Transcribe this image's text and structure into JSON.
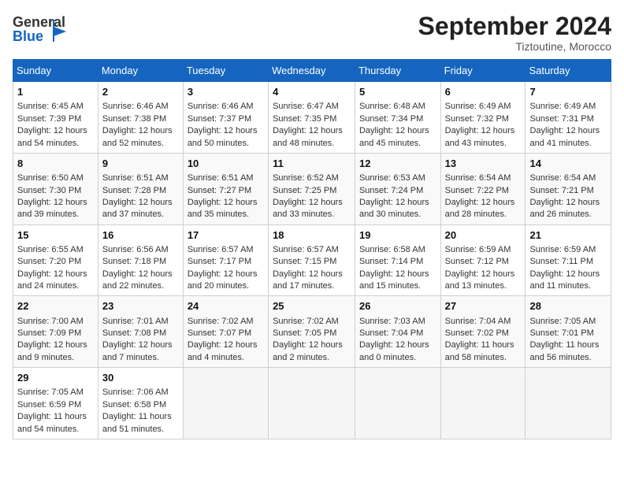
{
  "header": {
    "logo_general": "General",
    "logo_blue": "Blue",
    "month_title": "September 2024",
    "location": "Tiztoutine, Morocco"
  },
  "columns": [
    "Sunday",
    "Monday",
    "Tuesday",
    "Wednesday",
    "Thursday",
    "Friday",
    "Saturday"
  ],
  "weeks": [
    [
      {
        "day": "1",
        "sunrise": "Sunrise: 6:45 AM",
        "sunset": "Sunset: 7:39 PM",
        "daylight": "Daylight: 12 hours and 54 minutes."
      },
      {
        "day": "2",
        "sunrise": "Sunrise: 6:46 AM",
        "sunset": "Sunset: 7:38 PM",
        "daylight": "Daylight: 12 hours and 52 minutes."
      },
      {
        "day": "3",
        "sunrise": "Sunrise: 6:46 AM",
        "sunset": "Sunset: 7:37 PM",
        "daylight": "Daylight: 12 hours and 50 minutes."
      },
      {
        "day": "4",
        "sunrise": "Sunrise: 6:47 AM",
        "sunset": "Sunset: 7:35 PM",
        "daylight": "Daylight: 12 hours and 48 minutes."
      },
      {
        "day": "5",
        "sunrise": "Sunrise: 6:48 AM",
        "sunset": "Sunset: 7:34 PM",
        "daylight": "Daylight: 12 hours and 45 minutes."
      },
      {
        "day": "6",
        "sunrise": "Sunrise: 6:49 AM",
        "sunset": "Sunset: 7:32 PM",
        "daylight": "Daylight: 12 hours and 43 minutes."
      },
      {
        "day": "7",
        "sunrise": "Sunrise: 6:49 AM",
        "sunset": "Sunset: 7:31 PM",
        "daylight": "Daylight: 12 hours and 41 minutes."
      }
    ],
    [
      {
        "day": "8",
        "sunrise": "Sunrise: 6:50 AM",
        "sunset": "Sunset: 7:30 PM",
        "daylight": "Daylight: 12 hours and 39 minutes."
      },
      {
        "day": "9",
        "sunrise": "Sunrise: 6:51 AM",
        "sunset": "Sunset: 7:28 PM",
        "daylight": "Daylight: 12 hours and 37 minutes."
      },
      {
        "day": "10",
        "sunrise": "Sunrise: 6:51 AM",
        "sunset": "Sunset: 7:27 PM",
        "daylight": "Daylight: 12 hours and 35 minutes."
      },
      {
        "day": "11",
        "sunrise": "Sunrise: 6:52 AM",
        "sunset": "Sunset: 7:25 PM",
        "daylight": "Daylight: 12 hours and 33 minutes."
      },
      {
        "day": "12",
        "sunrise": "Sunrise: 6:53 AM",
        "sunset": "Sunset: 7:24 PM",
        "daylight": "Daylight: 12 hours and 30 minutes."
      },
      {
        "day": "13",
        "sunrise": "Sunrise: 6:54 AM",
        "sunset": "Sunset: 7:22 PM",
        "daylight": "Daylight: 12 hours and 28 minutes."
      },
      {
        "day": "14",
        "sunrise": "Sunrise: 6:54 AM",
        "sunset": "Sunset: 7:21 PM",
        "daylight": "Daylight: 12 hours and 26 minutes."
      }
    ],
    [
      {
        "day": "15",
        "sunrise": "Sunrise: 6:55 AM",
        "sunset": "Sunset: 7:20 PM",
        "daylight": "Daylight: 12 hours and 24 minutes."
      },
      {
        "day": "16",
        "sunrise": "Sunrise: 6:56 AM",
        "sunset": "Sunset: 7:18 PM",
        "daylight": "Daylight: 12 hours and 22 minutes."
      },
      {
        "day": "17",
        "sunrise": "Sunrise: 6:57 AM",
        "sunset": "Sunset: 7:17 PM",
        "daylight": "Daylight: 12 hours and 20 minutes."
      },
      {
        "day": "18",
        "sunrise": "Sunrise: 6:57 AM",
        "sunset": "Sunset: 7:15 PM",
        "daylight": "Daylight: 12 hours and 17 minutes."
      },
      {
        "day": "19",
        "sunrise": "Sunrise: 6:58 AM",
        "sunset": "Sunset: 7:14 PM",
        "daylight": "Daylight: 12 hours and 15 minutes."
      },
      {
        "day": "20",
        "sunrise": "Sunrise: 6:59 AM",
        "sunset": "Sunset: 7:12 PM",
        "daylight": "Daylight: 12 hours and 13 minutes."
      },
      {
        "day": "21",
        "sunrise": "Sunrise: 6:59 AM",
        "sunset": "Sunset: 7:11 PM",
        "daylight": "Daylight: 12 hours and 11 minutes."
      }
    ],
    [
      {
        "day": "22",
        "sunrise": "Sunrise: 7:00 AM",
        "sunset": "Sunset: 7:09 PM",
        "daylight": "Daylight: 12 hours and 9 minutes."
      },
      {
        "day": "23",
        "sunrise": "Sunrise: 7:01 AM",
        "sunset": "Sunset: 7:08 PM",
        "daylight": "Daylight: 12 hours and 7 minutes."
      },
      {
        "day": "24",
        "sunrise": "Sunrise: 7:02 AM",
        "sunset": "Sunset: 7:07 PM",
        "daylight": "Daylight: 12 hours and 4 minutes."
      },
      {
        "day": "25",
        "sunrise": "Sunrise: 7:02 AM",
        "sunset": "Sunset: 7:05 PM",
        "daylight": "Daylight: 12 hours and 2 minutes."
      },
      {
        "day": "26",
        "sunrise": "Sunrise: 7:03 AM",
        "sunset": "Sunset: 7:04 PM",
        "daylight": "Daylight: 12 hours and 0 minutes."
      },
      {
        "day": "27",
        "sunrise": "Sunrise: 7:04 AM",
        "sunset": "Sunset: 7:02 PM",
        "daylight": "Daylight: 11 hours and 58 minutes."
      },
      {
        "day": "28",
        "sunrise": "Sunrise: 7:05 AM",
        "sunset": "Sunset: 7:01 PM",
        "daylight": "Daylight: 11 hours and 56 minutes."
      }
    ],
    [
      {
        "day": "29",
        "sunrise": "Sunrise: 7:05 AM",
        "sunset": "Sunset: 6:59 PM",
        "daylight": "Daylight: 11 hours and 54 minutes."
      },
      {
        "day": "30",
        "sunrise": "Sunrise: 7:06 AM",
        "sunset": "Sunset: 6:58 PM",
        "daylight": "Daylight: 11 hours and 51 minutes."
      },
      null,
      null,
      null,
      null,
      null
    ]
  ]
}
